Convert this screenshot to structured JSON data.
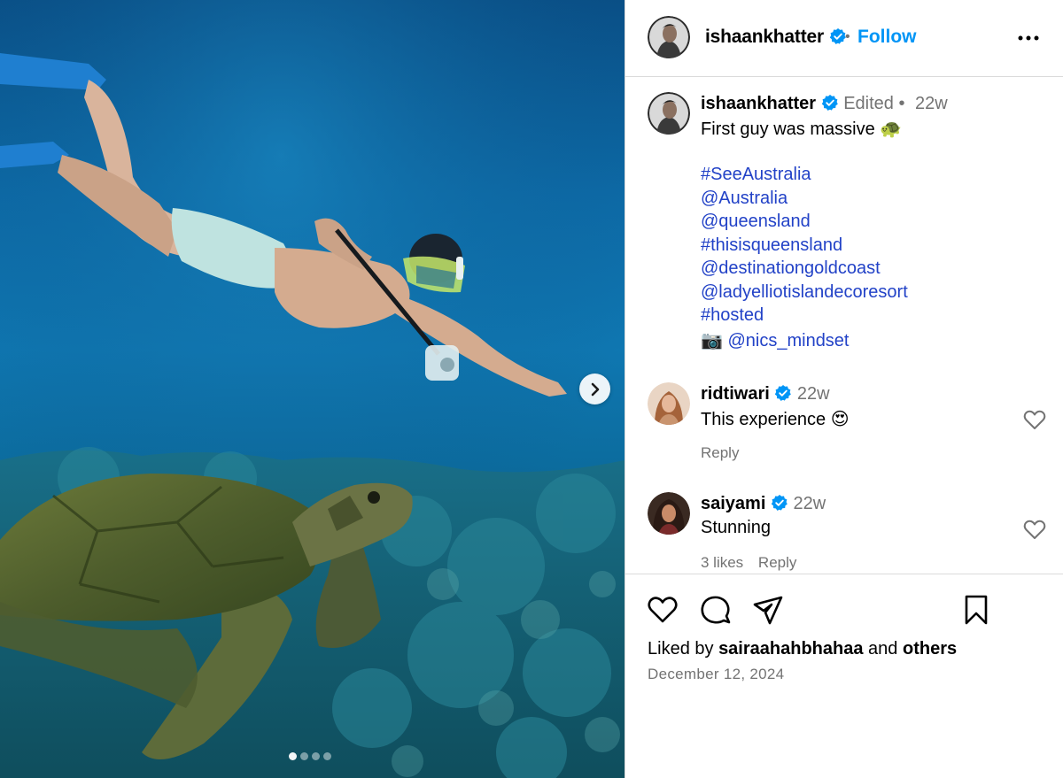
{
  "header": {
    "username": "ishaankhatter",
    "bullet": "•",
    "follow_label": "Follow"
  },
  "caption": {
    "username": "ishaankhatter",
    "edited": "Edited",
    "dot": "•",
    "time": "22w",
    "text": "First guy was massive",
    "emoji": "🐢",
    "tags": [
      "#SeeAustralia",
      "@Australia",
      "@queensland",
      "#thisisqueensland",
      "@destinationgoldcoast",
      "@ladyelliotislandecoresort",
      "#hosted"
    ],
    "camera_emoji": "📷",
    "credit": "@nics_mindset"
  },
  "comments": [
    {
      "username": "ridtiwari",
      "time": "22w",
      "text": "This experience",
      "emoji": "😍",
      "likes": "",
      "reply_label": "Reply"
    },
    {
      "username": "saiyami",
      "time": "22w",
      "text": "Stunning",
      "emoji": "",
      "likes": "3 likes",
      "reply_label": "Reply"
    }
  ],
  "footer": {
    "liked_prefix": "Liked by",
    "liked_user": "sairaahahbhahaa",
    "liked_and": "and",
    "liked_others": "others",
    "date": "December 12, 2024"
  },
  "carousel": {
    "total": 4,
    "active": 1
  },
  "icons": {
    "verified": "verified-badge-icon",
    "more": "more-options-icon",
    "like": "heart-icon",
    "comment": "comment-icon",
    "share": "share-icon",
    "save": "bookmark-icon",
    "next": "chevron-right-icon"
  },
  "colors": {
    "accent": "#0095f6",
    "link": "#2242c7",
    "verified": "#0095f6",
    "muted": "#737373"
  }
}
